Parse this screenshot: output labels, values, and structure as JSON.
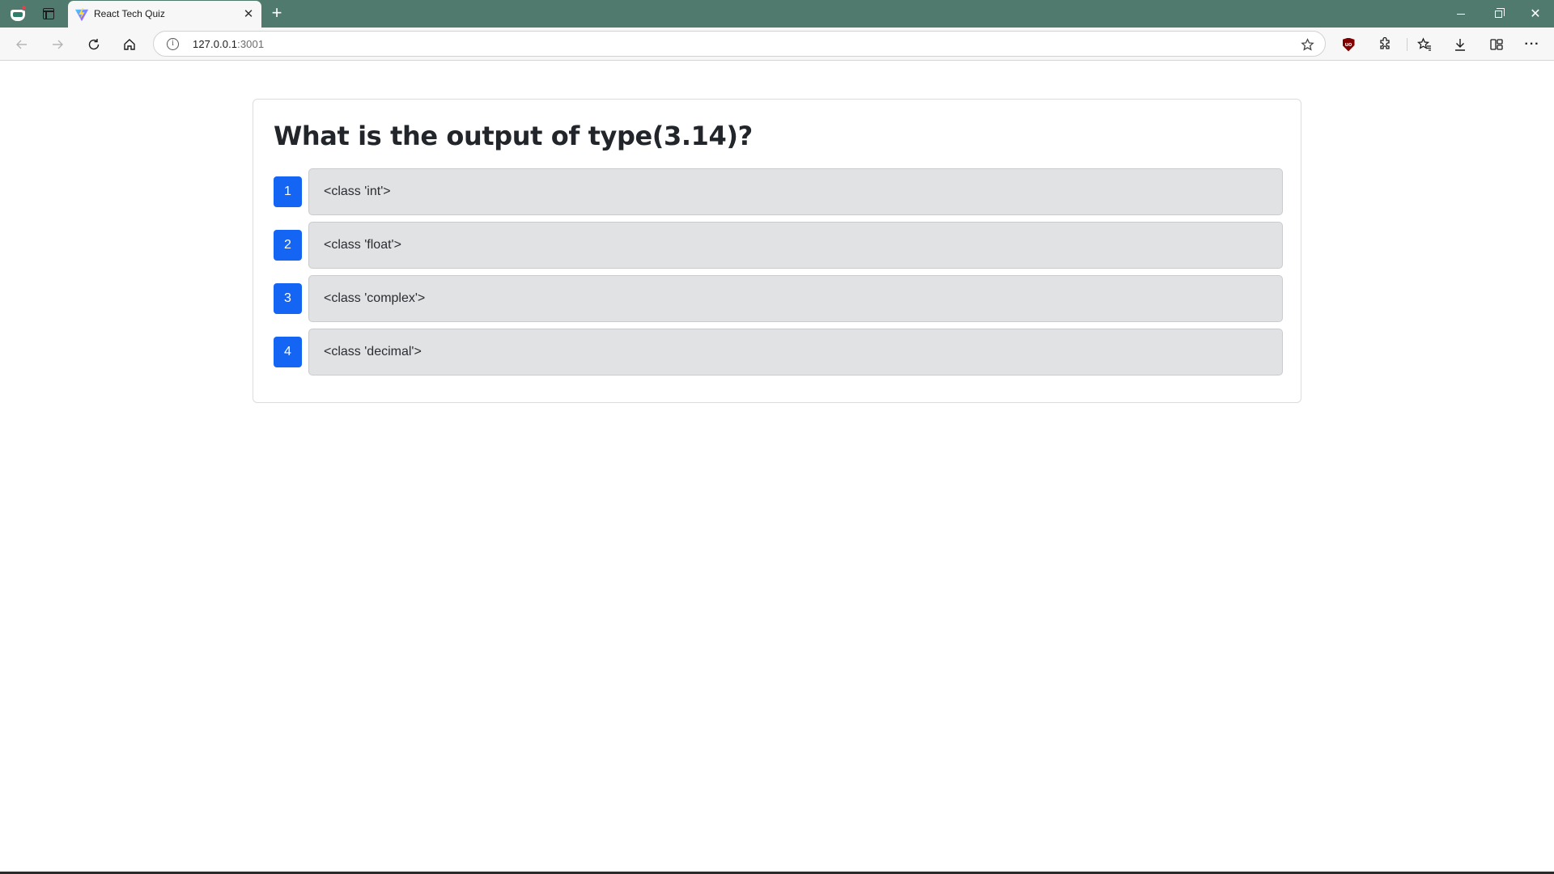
{
  "browser": {
    "tab_title": "React Tech Quiz",
    "new_tab_symbol": "+",
    "close_tab_symbol": "✕",
    "url_host": "127.0.0.1",
    "url_port": ":3001",
    "window_close_symbol": "✕",
    "more_symbol": "···",
    "theme_color": "#517a6f"
  },
  "quiz": {
    "question": "What is the output of type(3.14)?",
    "options": [
      {
        "number": "1",
        "text": "<class 'int'>"
      },
      {
        "number": "2",
        "text": "<class 'float'>"
      },
      {
        "number": "3",
        "text": "<class 'complex'>"
      },
      {
        "number": "4",
        "text": "<class 'decimal'>"
      }
    ],
    "accent_color": "#1565f5"
  }
}
